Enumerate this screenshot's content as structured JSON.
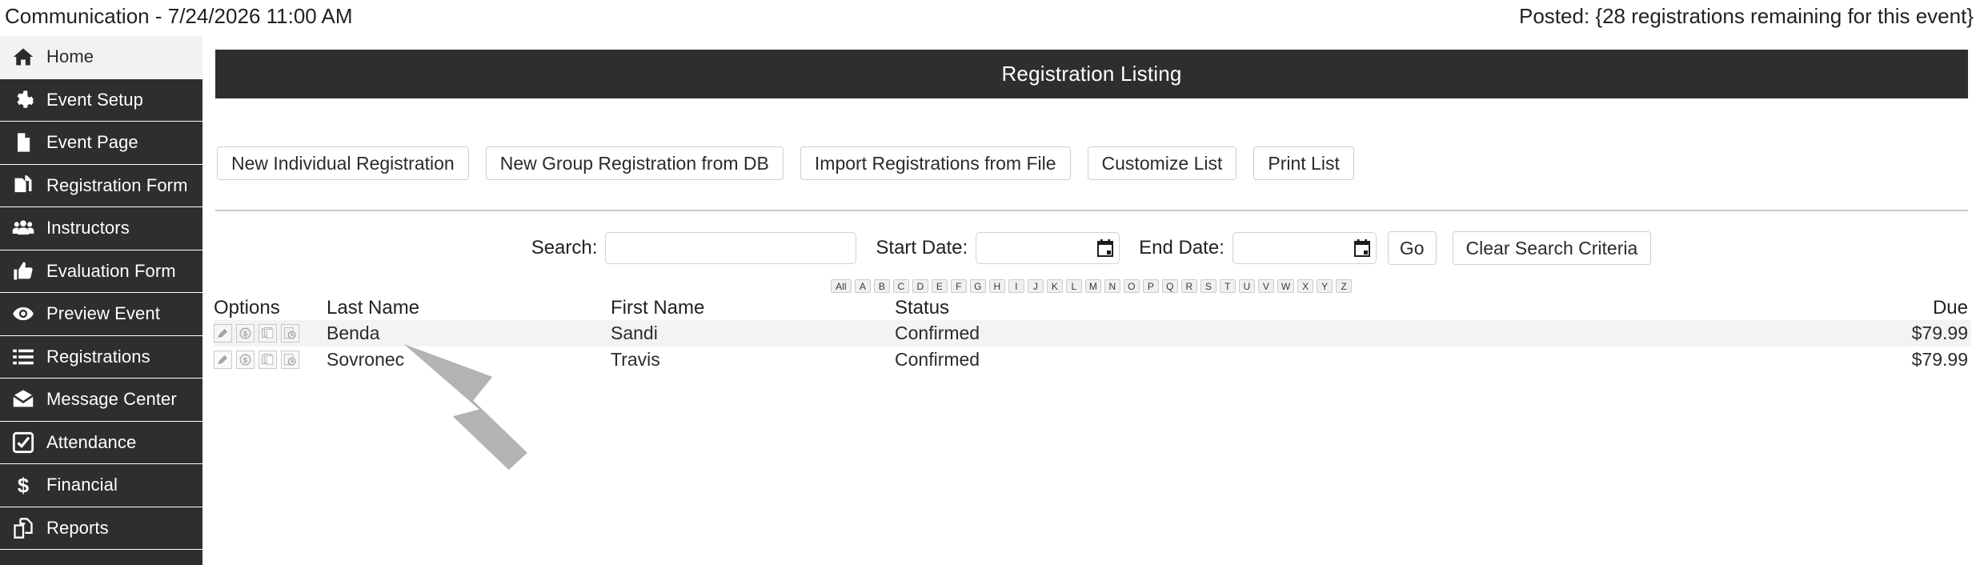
{
  "header": {
    "title": "Communication - 7/24/2026 11:00 AM",
    "posted": "Posted: {28 registrations remaining for this event}"
  },
  "sidebar": {
    "items": [
      {
        "label": "Home",
        "icon": "home-icon",
        "active": true
      },
      {
        "label": "Event Setup",
        "icon": "gear-icon",
        "active": false
      },
      {
        "label": "Event Page",
        "icon": "document-icon",
        "active": false
      },
      {
        "label": "Registration Form",
        "icon": "copy-documents-icon",
        "active": false
      },
      {
        "label": "Instructors",
        "icon": "users-icon",
        "active": false
      },
      {
        "label": "Evaluation Form",
        "icon": "thumbs-up-icon",
        "active": false
      },
      {
        "label": "Preview Event",
        "icon": "eye-icon",
        "active": false
      },
      {
        "label": "Registrations",
        "icon": "list-icon",
        "active": false
      },
      {
        "label": "Message Center",
        "icon": "envelope-icon",
        "active": false
      },
      {
        "label": "Attendance",
        "icon": "checkbox-checked-icon",
        "active": false
      },
      {
        "label": "Financial",
        "icon": "dollar-sign-icon",
        "active": false
      },
      {
        "label": "Reports",
        "icon": "reports-pages-icon",
        "active": false
      }
    ]
  },
  "banner": {
    "title": "Registration Listing"
  },
  "toolbar": {
    "buttons": [
      "New Individual Registration",
      "New Group Registration from DB",
      "Import Registrations from File",
      "Customize List",
      "Print List"
    ]
  },
  "search": {
    "search_label": "Search:",
    "search_value": "",
    "search_placeholder": "",
    "start_date_label": "Start Date:",
    "start_date_value": "",
    "start_date_placeholder": "",
    "end_date_label": "End Date:",
    "end_date_value": "",
    "end_date_placeholder": "",
    "go_label": "Go",
    "clear_label": "Clear Search Criteria",
    "calendar_icon": "calendar-icon"
  },
  "alphabet_filter": {
    "items": [
      "All",
      "A",
      "B",
      "C",
      "D",
      "E",
      "F",
      "G",
      "H",
      "I",
      "J",
      "K",
      "L",
      "M",
      "N",
      "O",
      "P",
      "Q",
      "R",
      "S",
      "T",
      "U",
      "V",
      "W",
      "X",
      "Y",
      "Z"
    ],
    "selected": ""
  },
  "table": {
    "columns": [
      "Options",
      "Last Name",
      "First Name",
      "Status",
      "Due"
    ],
    "row_option_icons": [
      "edit-pencil-icon",
      "payment-dollar-icon",
      "duplicate-icon",
      "history-clock-icon"
    ],
    "rows": [
      {
        "last_name": "Benda",
        "first_name": "Sandi",
        "status": "Confirmed",
        "due": "$79.99"
      },
      {
        "last_name": "Sovronec",
        "first_name": "Travis",
        "status": "Confirmed",
        "due": "$79.99"
      }
    ]
  },
  "annotation": {
    "arrow": "pointer-arrow-annotation",
    "color": "#b3b3b3"
  },
  "colors": {
    "sidebar_bg": "#2e2e2e",
    "banner_bg": "#2e2e2e",
    "active_nav_bg": "#f2f2f2",
    "row_alt_bg": "#f3f3f3",
    "text": "#222222"
  }
}
